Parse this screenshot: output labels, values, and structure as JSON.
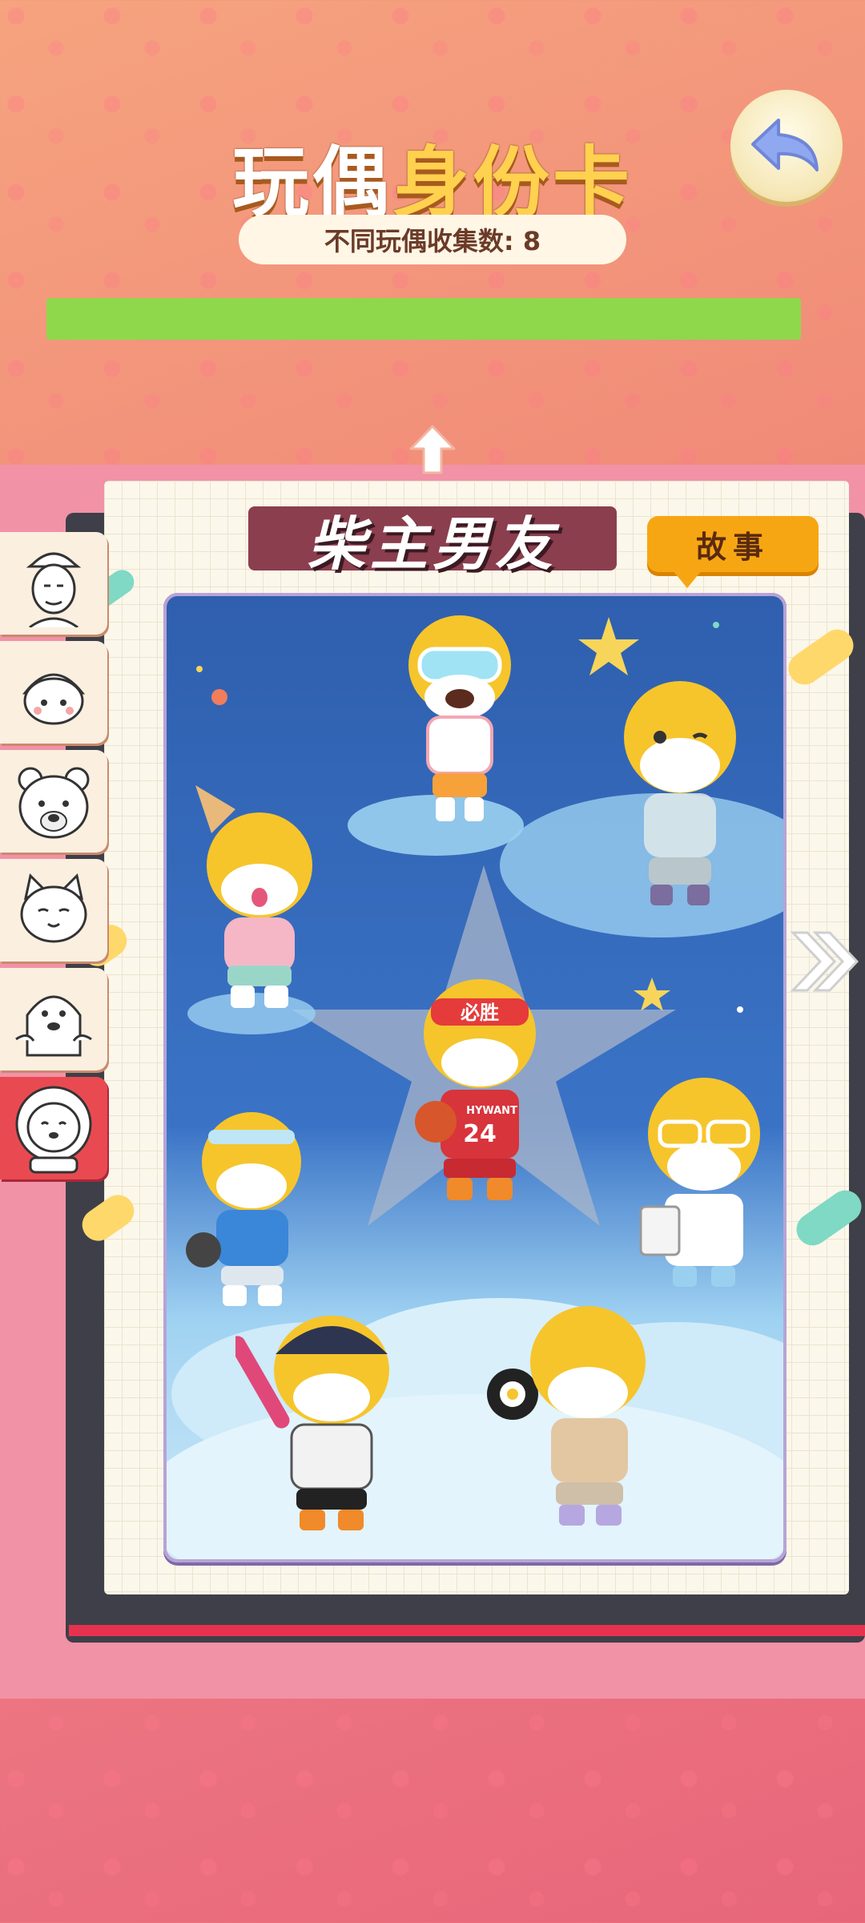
{
  "header": {
    "title_part1": "玩偶",
    "title_part2": "身份卡",
    "collection_count_label": "不同玩偶收集数: 8"
  },
  "progress": {
    "fraction": 1.0,
    "color_fill": "#8fd84c",
    "color_track": "#c9ee8d"
  },
  "card": {
    "name": "柴主男友",
    "story_button_label": "故事"
  },
  "side_tabs": [
    {
      "name": "old-man-doll",
      "active": false
    },
    {
      "name": "helmet-doll",
      "active": false
    },
    {
      "name": "polar-bear-doll",
      "active": false
    },
    {
      "name": "cat-doll",
      "active": false
    },
    {
      "name": "ghost-doll",
      "active": false
    },
    {
      "name": "lion-doll",
      "active": true
    }
  ],
  "figures": [
    {
      "name": "diver-shiba",
      "jersey": ""
    },
    {
      "name": "fairy-shiba",
      "jersey": ""
    },
    {
      "name": "icecream-shiba",
      "jersey": ""
    },
    {
      "name": "basketball-shiba",
      "headband": "必胜",
      "jersey": "24",
      "shirt_text": "HYWANT"
    },
    {
      "name": "tennis-shiba",
      "jersey": ""
    },
    {
      "name": "doctor-shiba",
      "jersey": ""
    },
    {
      "name": "baseball-shiba",
      "jersey": ""
    },
    {
      "name": "cook-shiba",
      "jersey": ""
    }
  ],
  "icons": {
    "back": "back-arrow-icon",
    "up": "up-arrow-icon",
    "next": "double-chevron-right-icon"
  }
}
